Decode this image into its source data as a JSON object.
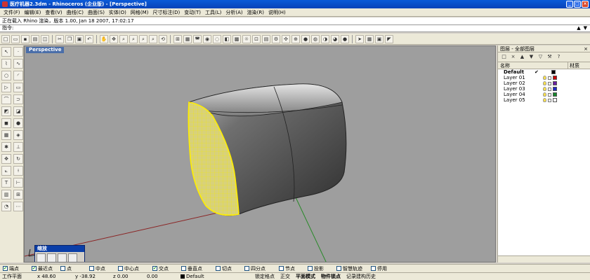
{
  "window": {
    "title": "医疗机器2.3dm - Rhinoceros (企业版) - [Perspective]"
  },
  "menu": [
    "文件(F)",
    "编辑(E)",
    "查看(V)",
    "曲线(C)",
    "曲面(S)",
    "实体(O)",
    "网格(M)",
    "尺寸标注(D)",
    "变动(T)",
    "工具(L)",
    "分析(A)",
    "渲染(R)",
    "说明(H)"
  ],
  "command": {
    "history": "正在载入 Rhino 渲染，版本 1.00, Jan 18 2007, 17:02:17",
    "prompt": "指令:",
    "value": ""
  },
  "viewport": {
    "tab": "Perspective"
  },
  "zoom_toolbar": {
    "title": "缩放"
  },
  "layers": {
    "header": "图层 - 全部图层",
    "col_name": "名称",
    "col_material": "材质",
    "items": [
      {
        "name": "Default",
        "current": true,
        "color": "#000000"
      },
      {
        "name": "Layer 01",
        "color": "#cc0000"
      },
      {
        "name": "Layer 02",
        "color": "#6a1fa3"
      },
      {
        "name": "Layer 03",
        "color": "#1f28c8"
      },
      {
        "name": "Layer 04",
        "color": "#16862c"
      },
      {
        "name": "Layer 05",
        "color": "#ffffff"
      }
    ]
  },
  "osnap": [
    {
      "label": "端点",
      "checked": true
    },
    {
      "label": "最近点",
      "checked": true
    },
    {
      "label": "点",
      "checked": false
    },
    {
      "label": "中点",
      "checked": false
    },
    {
      "label": "中心点",
      "checked": false
    },
    {
      "label": "交点",
      "checked": true
    },
    {
      "label": "垂直点",
      "checked": false
    },
    {
      "label": "切点",
      "checked": false
    },
    {
      "label": "四分点",
      "checked": false
    },
    {
      "label": "节点",
      "checked": false
    },
    {
      "label": "投影",
      "checked": false
    },
    {
      "label": "智慧轨迹",
      "checked": false
    },
    {
      "label": "停用",
      "checked": false
    }
  ],
  "status": {
    "cplane": "工作平面",
    "x": "x 48.60",
    "y": "y -38.92",
    "z": "z 0.00",
    "extra": "0.00",
    "layer": "Default",
    "items": [
      "锁定格点",
      "正交",
      "平面模式",
      "物件锁点",
      "记录建构历史"
    ]
  }
}
